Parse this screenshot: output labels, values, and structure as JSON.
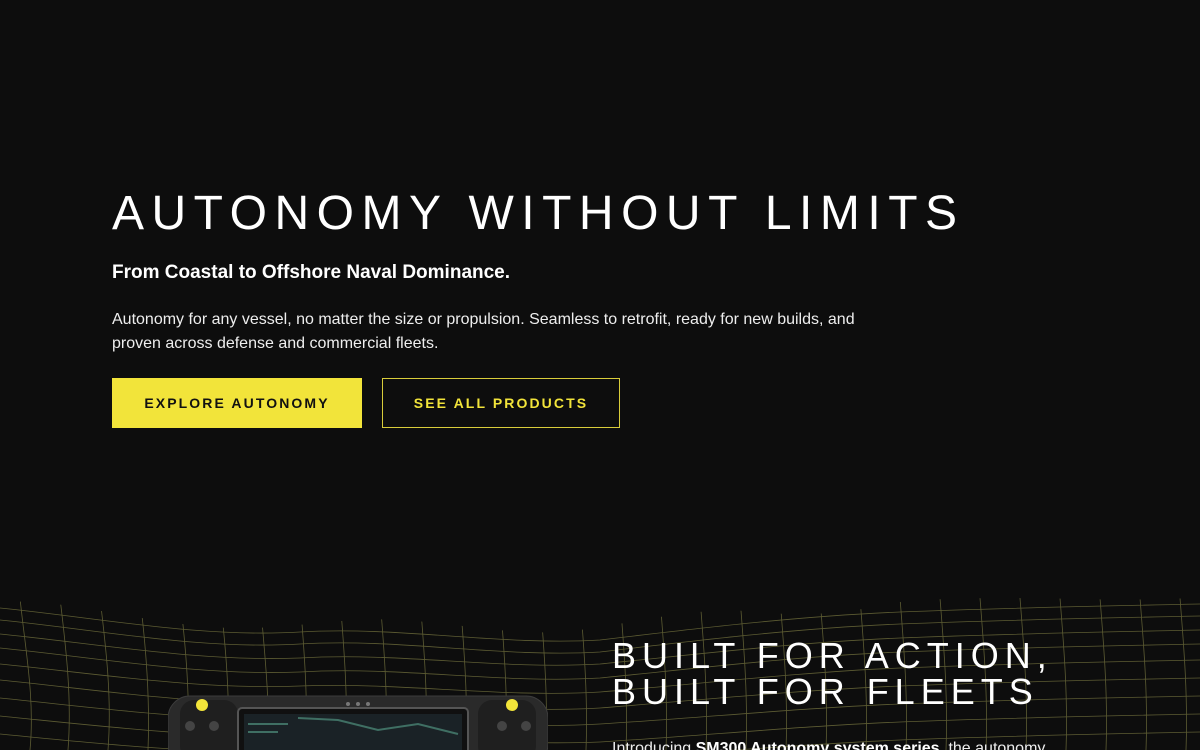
{
  "hero": {
    "title": "AUTONOMY WITHOUT LIMITS",
    "subtitle": "From Coastal to Offshore Naval Dominance.",
    "description": "Autonomy for any vessel, no matter the size or propulsion. Seamless to retrofit, ready for new builds, and proven across defense and commercial fleets.",
    "primary_button": "EXPLORE AUTONOMY",
    "secondary_button": "SEE ALL PRODUCTS"
  },
  "section2": {
    "heading_line1": "BUILT FOR ACTION,",
    "heading_line2": "BUILT FOR FLEETS",
    "intro_prefix": "Introducing ",
    "intro_bold": "SM300 Autonomy system series",
    "intro_suffix": ", the autonomy"
  },
  "colors": {
    "background": "#0d0d0d",
    "accent": "#f2e43a",
    "mesh": "#6b6a3a"
  }
}
